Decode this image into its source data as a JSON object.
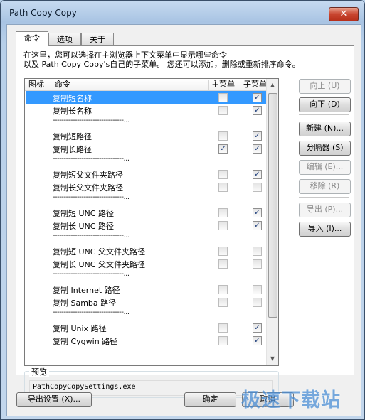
{
  "window": {
    "title": "Path Copy Copy",
    "close_glyph": "✕"
  },
  "tabs": [
    {
      "label": "命令"
    },
    {
      "label": "选项"
    },
    {
      "label": "关于"
    }
  ],
  "description": "在这里，您可以选择在主浏览器上下文菜单中显示哪些命令\n以及 Path Copy Copy's自己的子菜单。 您还可以添加，删除或重新排序命令。",
  "list": {
    "headers": {
      "icon": "图标",
      "command": "命令",
      "main": "主菜单",
      "sub": "子菜单"
    },
    "separator_text": "--------------------------------...",
    "rows": [
      {
        "label": "复制短名称",
        "main": false,
        "sub": true,
        "selected": true
      },
      {
        "label": "复制长名称",
        "main": false,
        "sub": true
      },
      {
        "separator": true
      },
      {
        "label": "复制短路径",
        "main": false,
        "sub": true
      },
      {
        "label": "复制长路径",
        "main": true,
        "sub": true
      },
      {
        "separator": true
      },
      {
        "label": "复制短父文件夹路径",
        "main": false,
        "sub": true
      },
      {
        "label": "复制长父文件夹路径",
        "main": false,
        "sub": false
      },
      {
        "separator": true
      },
      {
        "label": "复制短 UNC 路径",
        "main": false,
        "sub": true
      },
      {
        "label": "复制长 UNC 路径",
        "main": false,
        "sub": true
      },
      {
        "separator": true
      },
      {
        "label": "复制短 UNC 父文件夹路径",
        "main": false,
        "sub": false
      },
      {
        "label": "复制长 UNC 父文件夹路径",
        "main": false,
        "sub": false
      },
      {
        "separator": true
      },
      {
        "label": "复制 Internet 路径",
        "main": false,
        "sub": false
      },
      {
        "label": "复制 Samba 路径",
        "main": false,
        "sub": false
      },
      {
        "separator": true
      },
      {
        "label": "复制 Unix 路径",
        "main": false,
        "sub": true
      },
      {
        "label": "复制 Cygwin 路径",
        "main": false,
        "sub": true
      }
    ]
  },
  "side_buttons": {
    "move_up": "向上 (U)",
    "move_down": "向下 (D)",
    "new": "新建 (N)...",
    "separator": "分隔器 (S)",
    "edit": "编辑 (E)...",
    "remove": "移除 (R)",
    "export": "导出 (P)...",
    "import": "导入 (I)..."
  },
  "preview": {
    "legend": "预览",
    "value": "PathCopyCopySettings.exe"
  },
  "bottom_buttons": {
    "export_settings": "导出设置 (X)...",
    "ok": "确定",
    "cancel": "取消"
  },
  "watermark": "极速下载站",
  "colors": {
    "selection": "#3399ff",
    "title_bar": "#b9d1ea",
    "close_button": "#c8452f"
  }
}
